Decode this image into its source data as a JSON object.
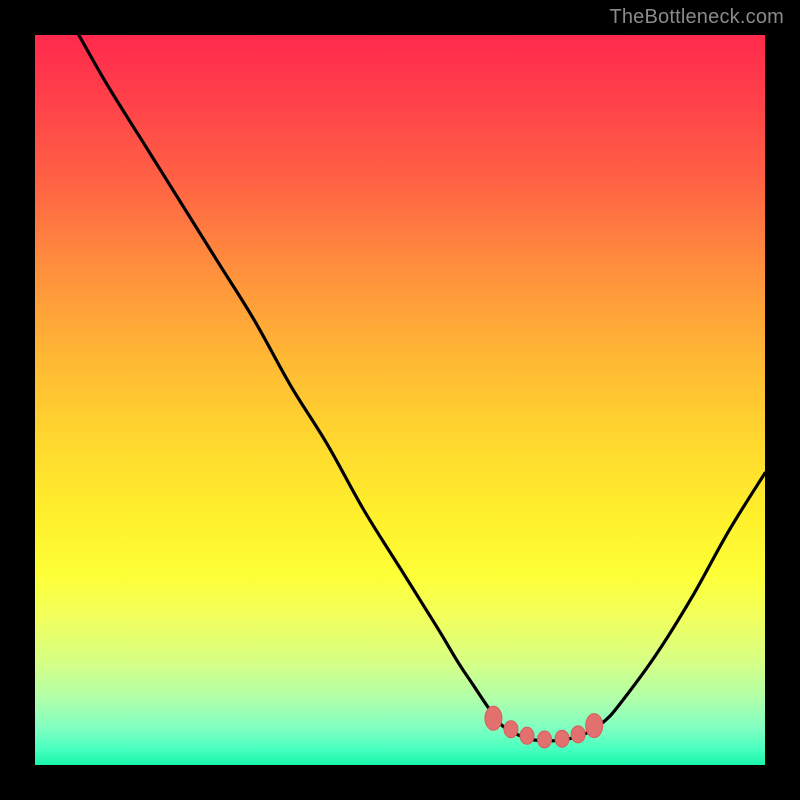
{
  "attribution": "TheBottleneck.com",
  "colors": {
    "page_background": "#000000",
    "curve_stroke": "#000000",
    "marker_fill": "#e2706f",
    "marker_stroke": "#d85d5c",
    "gradient_top": "#ff2a4d",
    "gradient_bottom": "#18f5a8"
  },
  "chart_data": {
    "type": "line",
    "title": "",
    "xlabel": "",
    "ylabel": "",
    "xlim": [
      0,
      100
    ],
    "ylim": [
      0,
      100
    ],
    "grid": false,
    "legend": false,
    "series": [
      {
        "name": "main-curve",
        "description": "V-shaped bottleneck curve: falls from upper-left, bottoms out between ~63 and ~77, rises toward upper-right",
        "x": [
          6,
          10,
          15,
          20,
          25,
          30,
          35,
          40,
          45,
          50,
          55,
          58,
          60,
          62,
          64,
          66,
          68,
          70,
          72,
          74,
          76,
          78,
          80,
          85,
          90,
          95,
          100
        ],
        "values": [
          100,
          93,
          85,
          77,
          69,
          61,
          52,
          44,
          35,
          27,
          19,
          14,
          11,
          8,
          5.4,
          4.2,
          3.5,
          3.3,
          3.4,
          3.8,
          4.6,
          6.0,
          8.2,
          15,
          23,
          32,
          40
        ]
      }
    ],
    "markers": {
      "description": "salmon oval markers highlighting the flat-bottom optimal region",
      "points": [
        {
          "x": 62.8,
          "y": 6.4
        },
        {
          "x": 65.2,
          "y": 4.9
        },
        {
          "x": 67.4,
          "y": 4.0
        },
        {
          "x": 69.8,
          "y": 3.5
        },
        {
          "x": 72.2,
          "y": 3.6
        },
        {
          "x": 74.4,
          "y": 4.2
        },
        {
          "x": 76.6,
          "y": 5.4
        }
      ]
    }
  }
}
